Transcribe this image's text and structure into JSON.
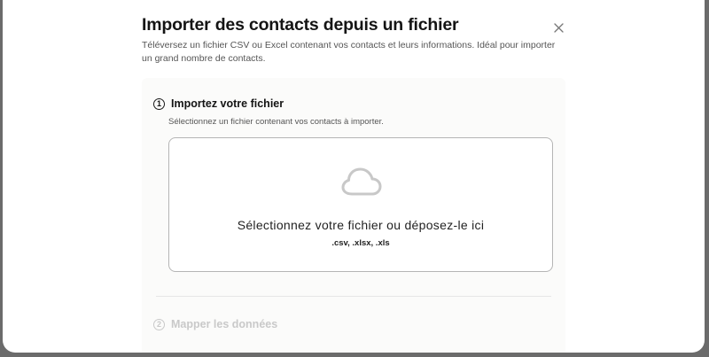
{
  "modal": {
    "title": "Importer des contacts depuis un fichier",
    "subtitle": "Téléversez un fichier CSV ou Excel contenant vos contacts et leurs informations. Idéal pour importer un grand nombre de contacts.",
    "close_icon": "close-icon"
  },
  "steps": [
    {
      "number": "1",
      "title": "Importez votre fichier",
      "description": "Sélectionnez un fichier contenant vos contacts à importer.",
      "state": "active"
    },
    {
      "number": "2",
      "title": "Mapper les données",
      "state": "disabled"
    }
  ],
  "dropzone": {
    "icon": "cloud-icon",
    "label": "Sélectionnez votre fichier ou déposez-le ici",
    "formats": ".csv, .xlsx, .xls"
  },
  "colors": {
    "disabled_text": "#c9c9c9",
    "border": "#b5b5b5"
  }
}
